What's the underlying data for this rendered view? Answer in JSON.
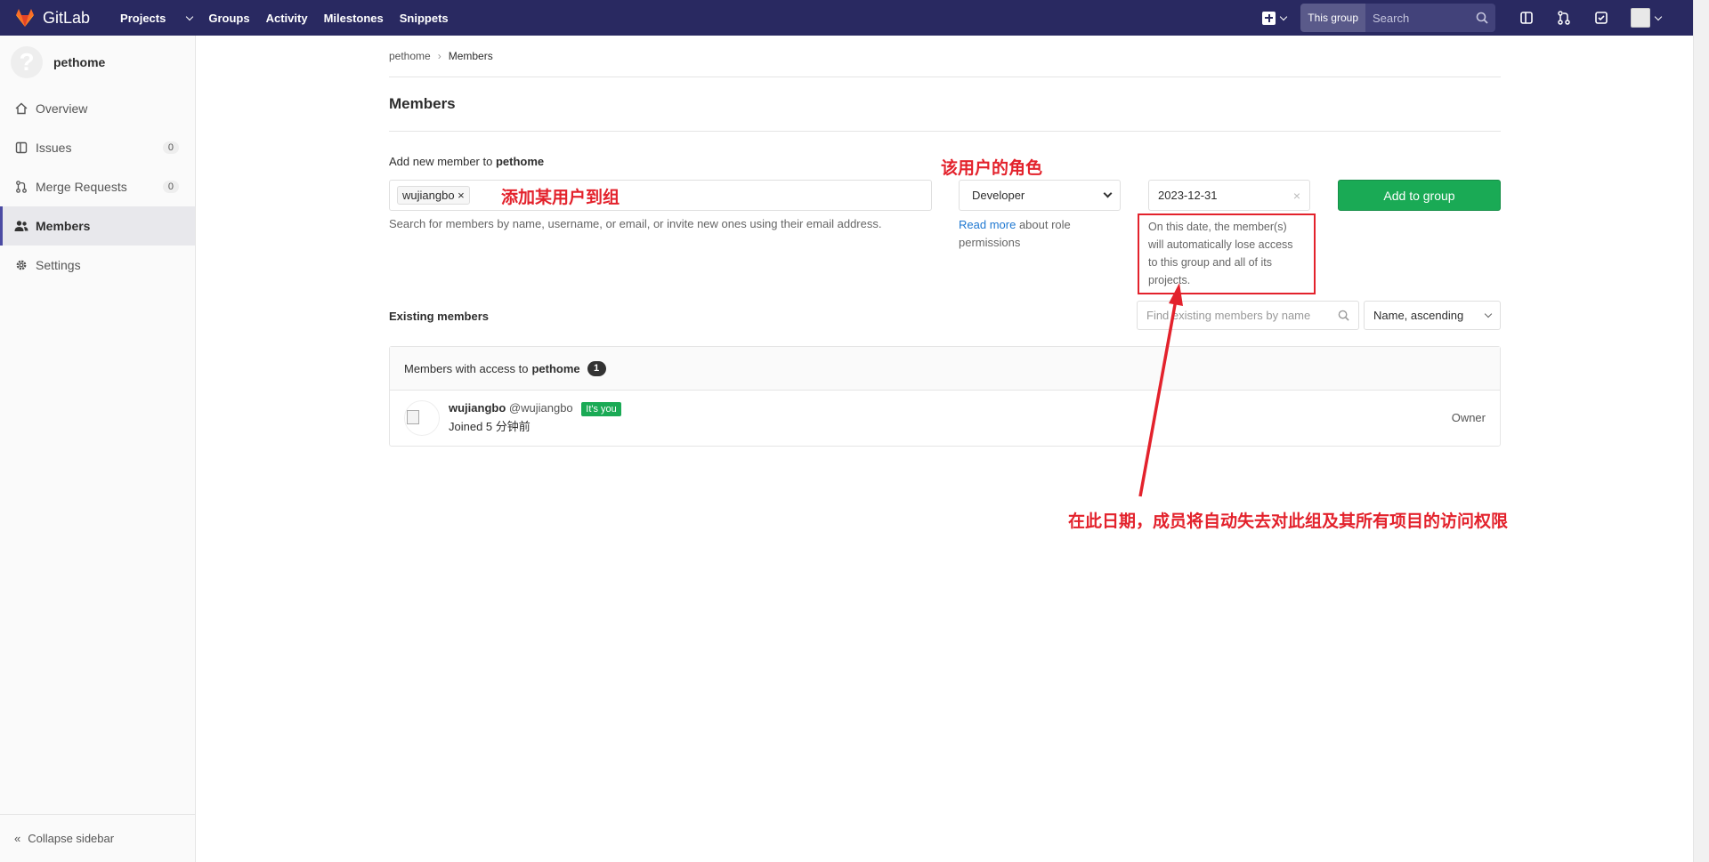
{
  "colors": {
    "topbar": "#292961",
    "accent_green": "#1aaa55",
    "link": "#1f78d1",
    "annotation_red": "#e3222c"
  },
  "topbar": {
    "logo_text": "GitLab",
    "nav": [
      "Projects",
      "Groups",
      "Activity",
      "Milestones",
      "Snippets"
    ],
    "search_scope": "This group",
    "search_placeholder": "Search",
    "icons": [
      "plus-icon",
      "sidebar-toggle-icon",
      "merge-request-icon",
      "todo-icon",
      "user-avatar-icon"
    ]
  },
  "sidebar": {
    "group_name": "pethome",
    "items": [
      {
        "label": "Overview",
        "icon": "home-icon",
        "count": ""
      },
      {
        "label": "Issues",
        "icon": "issues-icon",
        "count": "0"
      },
      {
        "label": "Merge Requests",
        "icon": "merge-request-icon",
        "count": "0"
      },
      {
        "label": "Members",
        "icon": "users-icon",
        "count": ""
      },
      {
        "label": "Settings",
        "icon": "gear-icon",
        "count": ""
      }
    ],
    "active": "Members",
    "collapse_label": "Collapse sidebar"
  },
  "breadcrumb": {
    "root": "pethome",
    "current": "Members"
  },
  "page": {
    "title": "Members",
    "add_label_prefix": "Add new member to",
    "add_label_group": "pethome",
    "selected_member": "wujiangbo",
    "member_hint": "Search for members by name, username, or email, or invite new ones using their email address.",
    "role_value": "Developer",
    "readmore_link": "Read more",
    "readmore_text": "about role permissions",
    "expiry_date": "2023-12-31",
    "expiry_note": "On this date, the member(s) will automatically lose access to this group and all of its projects.",
    "add_button": "Add to group",
    "existing_label": "Existing members",
    "find_placeholder": "Find existing members by name",
    "sort_value": "Name, ascending",
    "panel_title_prefix": "Members with access to",
    "panel_group": "pethome",
    "panel_count": "1"
  },
  "members": [
    {
      "name": "wujiangbo",
      "handle": "@wujiangbo",
      "badge": "It's you",
      "joined": "Joined 5 分钟前",
      "role": "Owner"
    }
  ],
  "annotations": {
    "add_user": "添加某用户到组",
    "role": "该用户的角色",
    "expiry": "在此日期，成员将自动失去对此组及其所有项目的访问权限"
  }
}
